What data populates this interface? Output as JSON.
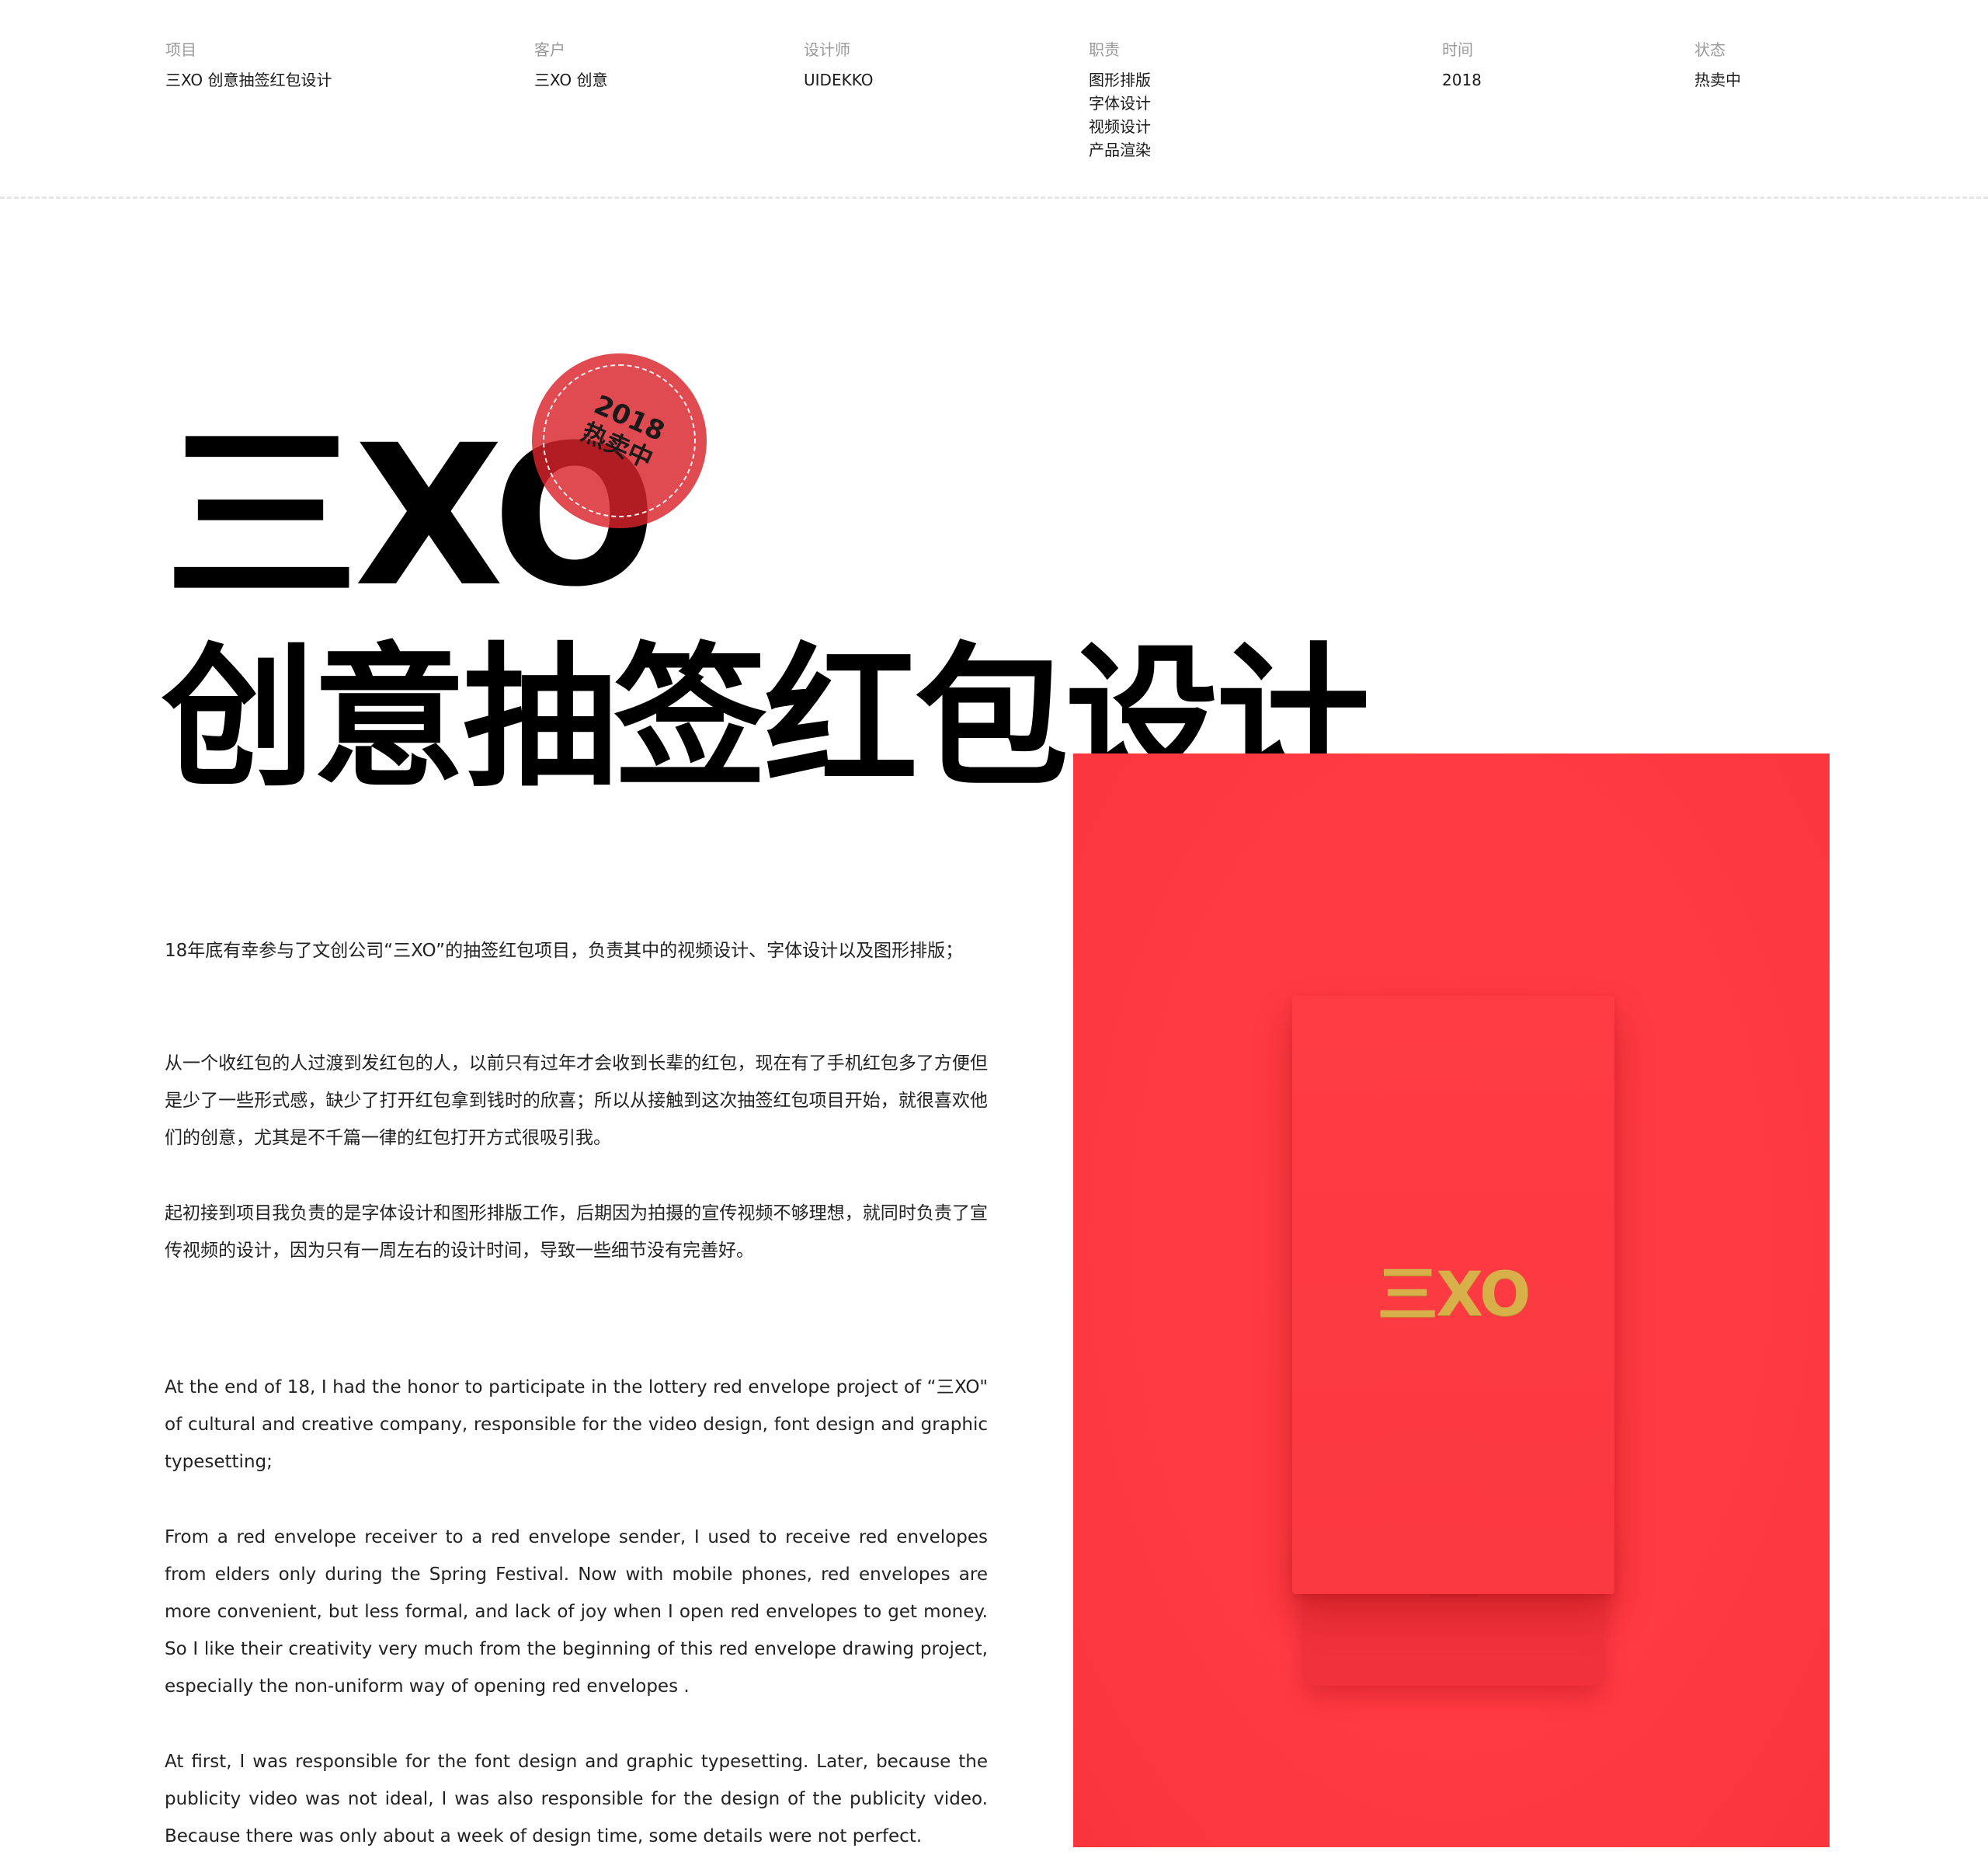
{
  "meta": {
    "project": {
      "label": "项目",
      "value": "三XO 创意抽签红包设计"
    },
    "client": {
      "label": "客户",
      "value": "三XO 创意"
    },
    "designer": {
      "label": "设计师",
      "value": "UIDEKKO"
    },
    "responsibilities": {
      "label": "职责",
      "items": [
        "图形排版",
        "字体设计",
        "视频设计",
        "产品渲染"
      ]
    },
    "time": {
      "label": "时间",
      "value": "2018"
    },
    "status": {
      "label": "状态",
      "value": "热卖中"
    }
  },
  "hero": {
    "title_line1": "三XO",
    "title_line2": "创意抽签红包设计"
  },
  "stamp": {
    "year": "2018",
    "status": "热卖中"
  },
  "intro_cn": [
    "18年底有幸参与了文创公司“三XO”的抽签红包项目，负责其中的视频设计、字体设计以及图形排版；",
    "从一个收红包的人过渡到发红包的人，以前只有过年才会收到长辈的红包，现在有了手机红包多了方便但是少了一些形式感，缺少了打开红包拿到钱时的欣喜；所以从接触到这次抽签红包项目开始，就很喜欢他们的创意，尤其是不千篇一律的红包打开方式很吸引我。",
    "起初接到项目我负责的是字体设计和图形排版工作，后期因为拍摄的宣传视频不够理想，就同时负责了宣传视频的设计，因为只有一周左右的设计时间，导致一些细节没有完善好。"
  ],
  "intro_en": [
    "At the end of 18, I had the honor to participate in the lottery red envelope project of “三XO\" of cultural and creative company, responsible for the video design, font design and graphic typesetting;",
    "From a red envelope receiver to a red envelope sender, I used to receive red envelopes from elders only during the Spring Festival. Now with mobile phones, red envelopes are more convenient, but less formal, and lack of joy when I open red envelopes to get money. So I like their creativity very much from the beginning of this red envelope drawing project, especially the non-uniform way of opening red envelopes .",
    "At first, I was responsible for the font design and graphic typesetting. Later, because the publicity video was not ideal, I was also responsible for the design of the publicity video. Because there was only about a week of design time, some details were not perfect."
  ],
  "product_image": {
    "logo_text": "三XO",
    "background_color": "#ff3a42",
    "logo_color": "#d8b04a"
  }
}
